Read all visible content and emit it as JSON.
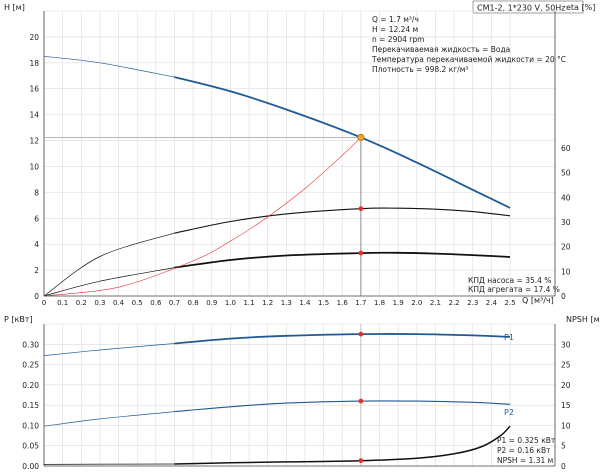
{
  "header": {
    "model": "CM1-2, 1*230 V, 50Hz"
  },
  "info_block": {
    "lines": [
      "Q = 1.7 м³/ч",
      "H = 12.24 м",
      "n = 2904 rpm",
      "Перекачиваемая жидкость = Вода",
      "Температура перекачиваемой жидкости = 20 °C",
      "Плотность = 998.2 кг/м³"
    ]
  },
  "efficiency_info": {
    "pump": "КПД насоса = 35.4 %",
    "unit": "КПД агрегата = 17.4 %"
  },
  "power_info": {
    "p1": "P1 = 0.325 кВт",
    "p2": "P2 = 0.16 кВт",
    "npsh": "NPSH = 1.31 м"
  },
  "colors": {
    "blue": "#1f5a96",
    "black": "#111111",
    "red": "#e23030",
    "orange": "#f5a623",
    "grid": "#dcdcdc"
  },
  "chart_data": [
    {
      "type": "line",
      "x_label": "Q [м³/ч]",
      "y_label": "H [м]",
      "y2_label": "eta [%]",
      "xlim": [
        0,
        2.5
      ],
      "ylim": [
        0,
        22
      ],
      "y2lim": [
        0,
        60
      ],
      "x_ticks": [
        "0",
        "0.1",
        "0.2",
        "0.3",
        "0.4",
        "0.5",
        "0.6",
        "0.7",
        "0.8",
        "0.9",
        "1.0",
        "1.1",
        "1.2",
        "1.3",
        "1.4",
        "1.5",
        "1.6",
        "1.7",
        "1.8",
        "1.9",
        "2.0",
        "2.1",
        "2.2",
        "2.3",
        "2.4",
        "2.5"
      ],
      "y_ticks": [
        "0",
        "2",
        "4",
        "6",
        "8",
        "10",
        "12",
        "14",
        "16",
        "18",
        "20"
      ],
      "y2_ticks": [
        "0",
        "10",
        "20",
        "30",
        "40",
        "50",
        "60"
      ],
      "series": [
        {
          "name": "H",
          "axis": "left",
          "color": "#1f5a96",
          "x": [
            0,
            0.3,
            0.7,
            1.0,
            1.3,
            1.7,
            2.0,
            2.3,
            2.5
          ],
          "y": [
            18.5,
            18.0,
            16.9,
            15.8,
            14.4,
            12.24,
            10.3,
            8.2,
            6.8
          ],
          "op_from": 0.7
        },
        {
          "name": "eta_pump",
          "axis": "right",
          "color": "#111111",
          "x": [
            0,
            0.3,
            0.7,
            1.0,
            1.3,
            1.7,
            1.9,
            2.1,
            2.3,
            2.5
          ],
          "y": [
            0,
            16,
            25.5,
            30.2,
            33.3,
            35.4,
            35.6,
            35.2,
            34.2,
            32.5
          ],
          "op_from": 0.7
        },
        {
          "name": "eta_unit",
          "axis": "right",
          "color": "#111111",
          "x": [
            0,
            0.3,
            0.7,
            1.0,
            1.3,
            1.7,
            1.9,
            2.1,
            2.3,
            2.5
          ],
          "y": [
            0,
            6,
            11.5,
            14.6,
            16.4,
            17.4,
            17.5,
            17.2,
            16.6,
            15.8
          ],
          "op_from": 0.7
        },
        {
          "name": "system",
          "axis": "left",
          "color": "#e23030",
          "x": [
            0,
            0.4,
            0.8,
            1.0,
            1.2,
            1.4,
            1.6,
            1.7
          ],
          "y": [
            0,
            0.68,
            2.71,
            4.24,
            6.1,
            8.3,
            10.85,
            12.24
          ],
          "op_from": 0
        }
      ],
      "operating_point": {
        "q": 1.7,
        "h": 12.24,
        "eta_pump": 35.4,
        "eta_unit": 17.4
      }
    },
    {
      "type": "line",
      "x_label": "",
      "y_label": "P [кВт]",
      "y2_label": "NPSH [м]",
      "xlim": [
        0,
        2.5
      ],
      "ylim": [
        0,
        0.35
      ],
      "y2lim": [
        0,
        35
      ],
      "y_ticks": [
        "0.00",
        "0.05",
        "0.10",
        "0.15",
        "0.20",
        "0.25",
        "0.30"
      ],
      "y2_ticks": [
        "0",
        "5",
        "10",
        "15",
        "20",
        "25",
        "30"
      ],
      "series": [
        {
          "name": "P1",
          "axis": "left",
          "color": "#1f5a96",
          "x": [
            0,
            0.3,
            0.7,
            1.0,
            1.3,
            1.7,
            2.0,
            2.3,
            2.5
          ],
          "y": [
            0.272,
            0.286,
            0.302,
            0.314,
            0.321,
            0.325,
            0.325,
            0.322,
            0.318
          ],
          "op_from": 0.7
        },
        {
          "name": "P2",
          "axis": "left",
          "color": "#1f5a96",
          "x": [
            0,
            0.3,
            0.7,
            1.0,
            1.3,
            1.7,
            2.0,
            2.3,
            2.5
          ],
          "y": [
            0.098,
            0.116,
            0.134,
            0.146,
            0.155,
            0.16,
            0.16,
            0.157,
            0.152
          ],
          "op_from": 0.7
        },
        {
          "name": "NPSH",
          "axis": "right",
          "color": "#111111",
          "x": [
            0,
            0.7,
            1.0,
            1.3,
            1.7,
            2.0,
            2.2,
            2.35,
            2.45,
            2.5
          ],
          "y": [
            0.4,
            0.5,
            0.8,
            1.0,
            1.31,
            1.9,
            3.0,
            4.8,
            7.5,
            9.8
          ],
          "op_from": 0.7
        }
      ],
      "series_labels": [
        "P1",
        "P2"
      ],
      "operating_point": {
        "q": 1.7,
        "p1": 0.325,
        "p2": 0.16,
        "npsh": 1.31
      }
    }
  ]
}
